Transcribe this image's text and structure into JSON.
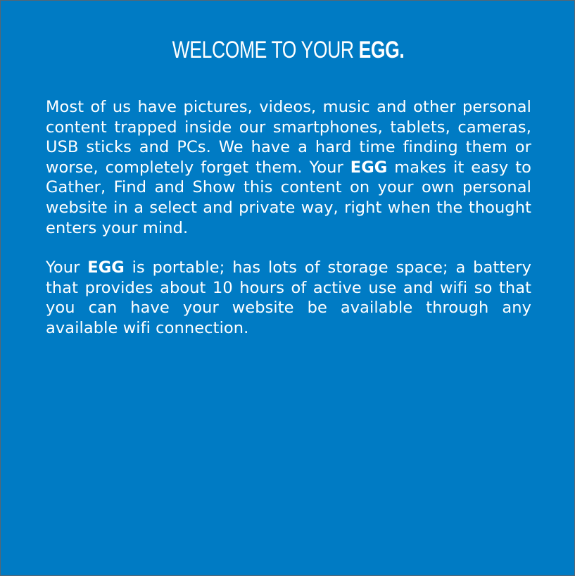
{
  "title": {
    "prefix": "WELCOME TO YOUR ",
    "emphasis": "EGG."
  },
  "paragraphs": [
    {
      "parts": [
        "Most of us have pictures, videos, music and other personal content trapped inside our smartphones, tablets, cameras, USB sticks and PCs. We have a hard time finding them or worse, completely forget them. Your ",
        "EGG",
        " makes it easy to Gather, Find and Show this content on your own personal website in a select and private way, right when the thought enters your mind."
      ]
    },
    {
      "parts": [
        "Your ",
        "EGG",
        " is portable; has lots of storage space; a battery that provides about 10 hours of active use and wifi so that you can have your website be available through any available wifi connection."
      ]
    }
  ],
  "colors": {
    "background": "#007bc4",
    "text": "#ffffff",
    "border": "#5a6670"
  }
}
